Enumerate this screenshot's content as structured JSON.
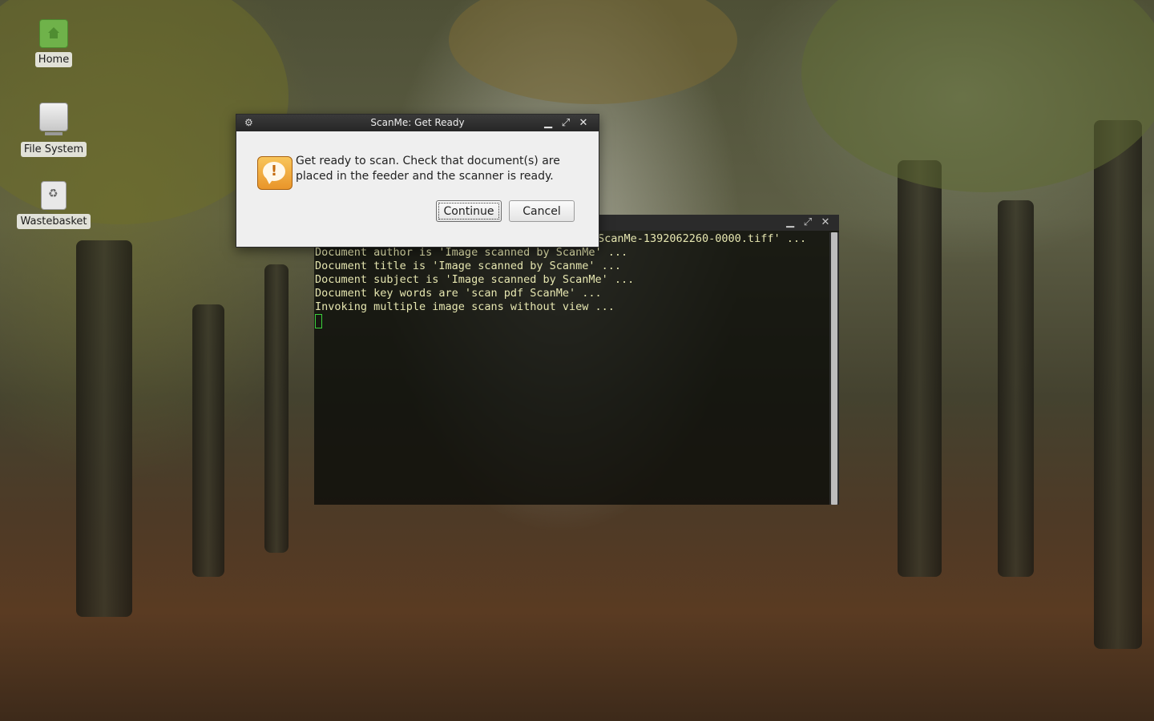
{
  "desktop": {
    "icons": [
      {
        "label": "Home"
      },
      {
        "label": "File System"
      },
      {
        "label": "Wastebasket"
      }
    ]
  },
  "terminal": {
    "lines": [
      "ScanMe-1392062260-0000.tiff' ...",
      "Document author is 'Image scanned by ScanMe' ...",
      "Document title is 'Image scanned by Scanme' ...",
      "Document subject is 'Image scanned by ScanMe' ...",
      "Document key words are 'scan pdf ScanMe' ...",
      "Invoking multiple image scans without view ..."
    ],
    "controls": {
      "minimize": "▁",
      "maximize": "⤢",
      "close": "✕"
    }
  },
  "dialog": {
    "title": "ScanMe: Get Ready",
    "message": "Get ready to scan. Check that document(s) are placed in the feeder and the scanner is ready.",
    "continue_label": "Continue",
    "cancel_label": "Cancel",
    "controls": {
      "menu": "⚙",
      "minimize": "▁",
      "maximize": "⤢",
      "close": "✕"
    },
    "icon": "warning-icon"
  },
  "colors": {
    "terminal_text": "#e6e6b0",
    "cursor": "#3bd13b",
    "dialog_bg": "#efefef",
    "titlebar": "#2b2b2b"
  }
}
